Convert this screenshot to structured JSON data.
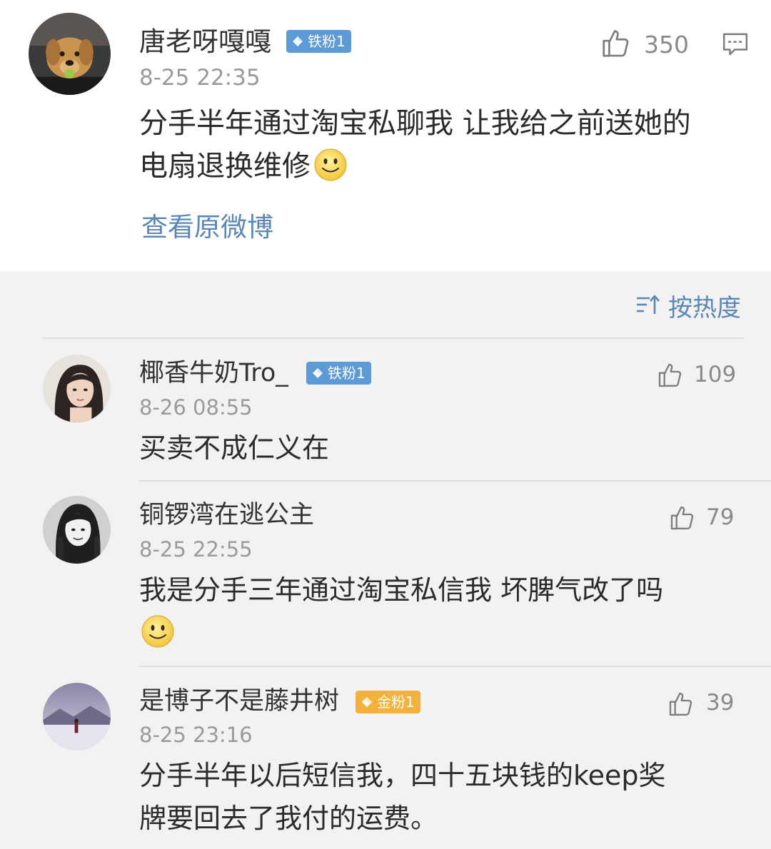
{
  "main_post": {
    "username": "唐老呀嘎嘎",
    "badge": "铁粉1",
    "timestamp": "8-25 22:35",
    "likes": "350",
    "content_line1": "分手半年通过淘宝私聊我 让我给之前送她的",
    "content_line2": "电扇退换维修",
    "view_original": "查看原微博"
  },
  "sort": {
    "label": "按热度"
  },
  "comments": [
    {
      "username": "椰香牛奶Tro_",
      "badge": "铁粉1",
      "timestamp": "8-26 08:55",
      "likes": "109",
      "content_line1": "买卖不成仁义在"
    },
    {
      "username": "铜锣湾在逃公主",
      "timestamp": "8-25 22:55",
      "likes": "79",
      "content_line1": "我是分手三年通过淘宝私信我 坏脾气改了吗"
    },
    {
      "username": "是博子不是藤井树",
      "badge": "金粉1",
      "timestamp": "8-25 23:16",
      "likes": "39",
      "content_line1": "分手半年以后短信我，四十五块钱的keep奖",
      "content_line2": "牌要回去了我付的运费。"
    }
  ],
  "colors": {
    "link": "#5b87b8",
    "badge_blue": "#5d9bd8",
    "badge_gold": "#f3b13e",
    "timestamp": "#9a9a9a"
  },
  "icons": [
    "thumbs-up-icon",
    "comment-icon",
    "sort-icon",
    "smile-emoji-icon",
    "diamond-icon"
  ]
}
